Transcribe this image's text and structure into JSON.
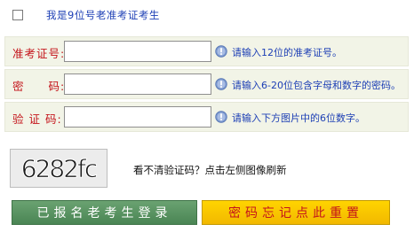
{
  "checkbox": {
    "label": "我是9位号老准考证考生",
    "checked": false
  },
  "fields": [
    {
      "label": "准考证号:",
      "value": "",
      "hint": "请输入12位的准考证号。"
    },
    {
      "label": "密　　码:",
      "value": "",
      "hint": "请输入6-20位包含字母和数字的密码。"
    },
    {
      "label": "验 证 码:",
      "value": "",
      "hint": "请输入下方图片中的6位数字。"
    }
  ],
  "captcha": {
    "text": "6282fc",
    "hint": "看不清验证码？点击左侧图像刷新"
  },
  "buttons": {
    "login": "已报名老考生登录",
    "reset": "密码忘记点此重置"
  },
  "colors": {
    "label_red": "#c4141b",
    "link_blue": "#1d3fb5",
    "row_bg": "#f2f4e7",
    "login_green": "#5a9563",
    "reset_yellow": "#ffd400"
  }
}
